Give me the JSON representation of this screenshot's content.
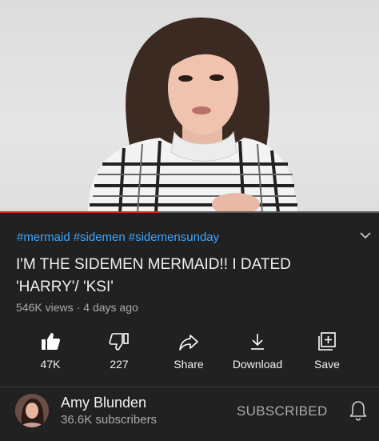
{
  "video": {
    "progress": 0.42,
    "thumbnail_icon": "person-talking-thumbnail"
  },
  "hashtags": [
    "#mermaid",
    "#sidemen",
    "#sidemensunday"
  ],
  "title": "I'M THE SIDEMEN MERMAID!! I DATED 'HARRY'/ 'KSI'",
  "views": "546K views",
  "age": "4 days ago",
  "actions": {
    "like": {
      "label": "47K",
      "icon": "thumbs-up-filled-icon"
    },
    "dislike": {
      "label": "227",
      "icon": "thumbs-down-icon"
    },
    "share": {
      "label": "Share",
      "icon": "share-arrow-icon"
    },
    "download": {
      "label": "Download",
      "icon": "download-icon"
    },
    "save": {
      "label": "Save",
      "icon": "add-to-playlist-icon"
    }
  },
  "channel": {
    "name": "Amy Blunden",
    "subscribers": "36.6K subscribers",
    "subscribe_label": "SUBSCRIBED",
    "bell_icon": "bell-icon"
  },
  "colors": {
    "background": "#212121",
    "hashtag": "#3ea6ff",
    "progress": "#e62117",
    "secondary_text": "#aaaaaa"
  }
}
